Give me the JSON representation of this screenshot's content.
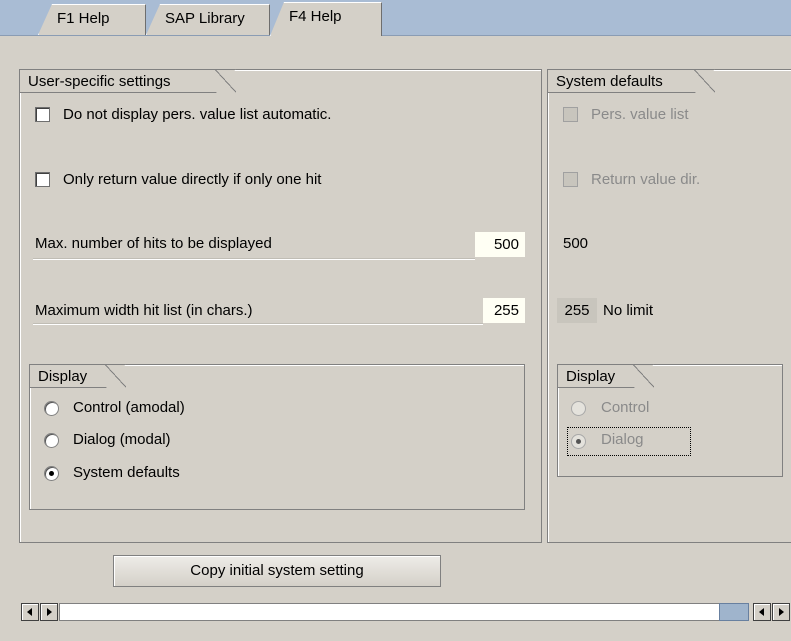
{
  "tabs": [
    {
      "label": "F1 Help",
      "active": false
    },
    {
      "label": "SAP Library",
      "active": false
    },
    {
      "label": "F4 Help",
      "active": true
    }
  ],
  "user_settings": {
    "title": "User-specific settings",
    "no_auto_list_label": "Do not display pers. value list automatic.",
    "no_auto_list_checked": false,
    "return_direct_label": "Only return value directly if only one hit",
    "return_direct_checked": false,
    "max_hits_label": "Max. number of hits to be displayed",
    "max_hits_value": "500",
    "max_width_label": "Maximum width hit list (in chars.)",
    "max_width_value": "255",
    "display": {
      "title": "Display",
      "options": [
        "Control (amodal)",
        "Dialog (modal)",
        "System defaults"
      ],
      "selected": "System defaults"
    }
  },
  "system_defaults": {
    "title": "System defaults",
    "pers_list_label": "Pers. value list",
    "return_dir_label": "Return value dir.",
    "max_hits_value": "500",
    "max_width_value": "255",
    "max_width_suffix": "No limit",
    "display": {
      "title": "Display",
      "options": [
        "Control",
        "Dialog"
      ],
      "selected": "Dialog"
    }
  },
  "copy_button_label": "Copy initial system setting",
  "colors": {
    "tabstrip_bg": "#a9bcd4",
    "panel_bg": "#d4d0c8",
    "input_bg": "#fffff4",
    "scroll_thumb": "#9fb4cc"
  }
}
